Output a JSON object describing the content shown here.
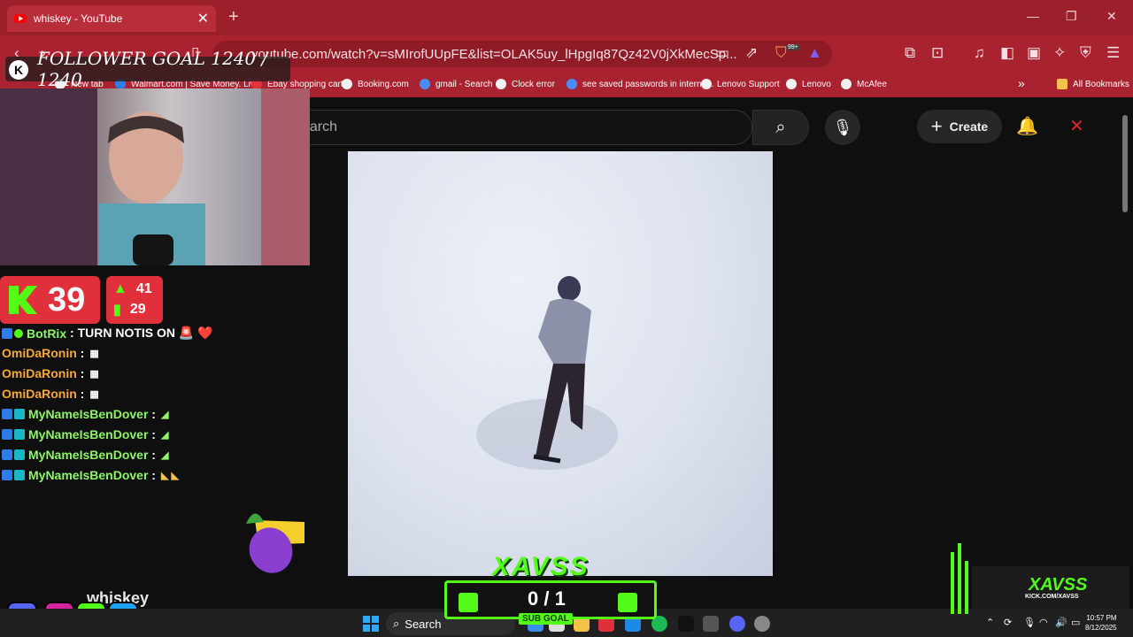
{
  "browser": {
    "tab_title": "whiskey - YouTube",
    "new_tab": "+",
    "url": "youtube.com/watch?v=sMIrofUUpFE&list=OLAK5uy_lHpgIq87Qz42V0jXkMecSp...",
    "bookmarks": [
      "New tab",
      "Walmart.com | Save Money. Liv...",
      "Ebay shopping cart",
      "Booking.com",
      "gmail - Search",
      "Clock error",
      "see saved passwords in interne...",
      "Lenovo Support",
      "Lenovo",
      "McAfee"
    ],
    "all_bookmarks": "All Bookmarks",
    "badge_count": "99+"
  },
  "youtube": {
    "search_placeholder": "earch",
    "create_label": "Create"
  },
  "stream": {
    "follower_goal": "FOLLOWER GOAL 1240 / 1240",
    "viewers": "39",
    "stat_up": "41",
    "stat_bars": "29",
    "song_title": "whiskey",
    "sub_goal_brand": "XAVSS",
    "sub_goal_count": "0 / 1",
    "sub_goal_label": "SUB GOAL",
    "brand_name": "XAVSS",
    "brand_url": "KICK.COM/XAVSS"
  },
  "chat": [
    {
      "user": "BotRix",
      "message": ": TURN NOTIS ON 🚨 ❤️",
      "color": "#8ef56a"
    },
    {
      "user": "OmiDaRonin",
      "message": ":",
      "color": "#f6a93b"
    },
    {
      "user": "OmiDaRonin",
      "message": ":",
      "color": "#f6a93b"
    },
    {
      "user": "OmiDaRonin",
      "message": ":",
      "color": "#f6a93b"
    },
    {
      "user": "MyNameIsBenDover",
      "message": ":",
      "color": "#8ef56a"
    },
    {
      "user": "MyNameIsBenDover",
      "message": ":",
      "color": "#8ef56a"
    },
    {
      "user": "MyNameIsBenDover",
      "message": ":",
      "color": "#8ef56a"
    },
    {
      "user": "MyNameIsBenDover",
      "message": ":",
      "color": "#8ef56a"
    }
  ],
  "taskbar": {
    "search_label": "Search",
    "time": "10:57 PM",
    "date": "8/12/2025"
  },
  "colors": {
    "browser_red": "#a8222f",
    "kick_green": "#53fc18",
    "stat_red": "#e0303b"
  },
  "icons": [
    "youtube-favicon",
    "search-icon",
    "mic-icon",
    "plus-icon",
    "bell-icon",
    "close-icon",
    "kick-icon",
    "discord-icon",
    "instagram-icon",
    "twitter-icon",
    "windows-icon"
  ]
}
